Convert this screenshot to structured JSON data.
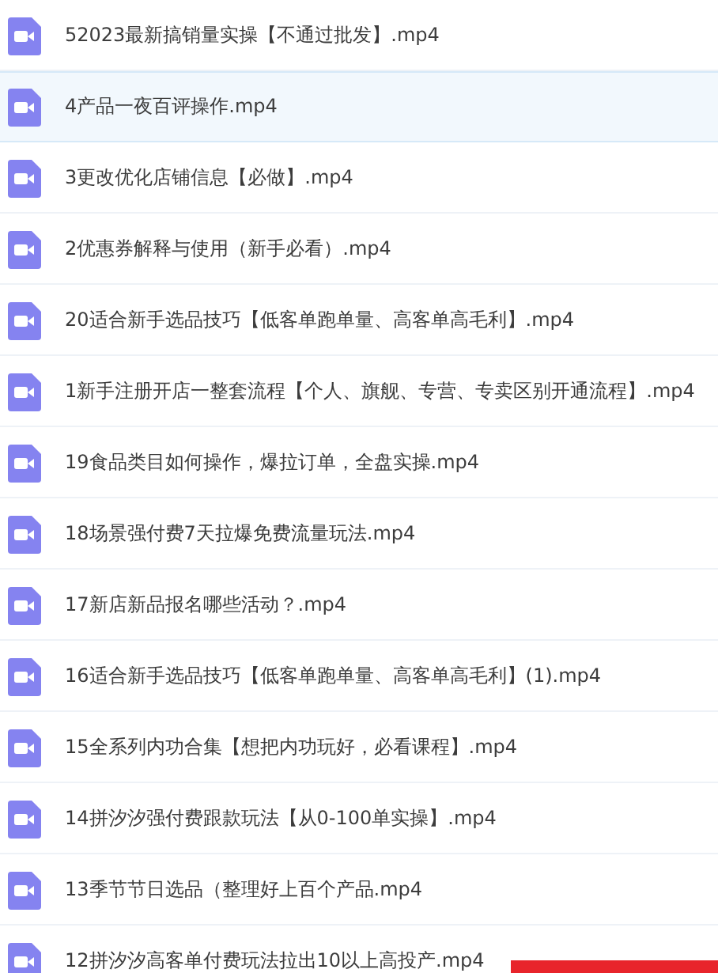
{
  "files": [
    {
      "name": "52023最新搞销量实操【不通过批发】.mp4",
      "selected": false
    },
    {
      "name": "4产品一夜百评操作.mp4",
      "selected": true
    },
    {
      "name": "3更改优化店铺信息【必做】.mp4",
      "selected": false
    },
    {
      "name": "2优惠券解释与使用（新手必看）.mp4",
      "selected": false
    },
    {
      "name": "20适合新手选品技巧【低客单跑单量、高客单高毛利】.mp4",
      "selected": false
    },
    {
      "name": "1新手注册开店一整套流程【个人、旗舰、专营、专卖区别开通流程】.mp4",
      "selected": false
    },
    {
      "name": "19食品类目如何操作，爆拉订单，全盘实操.mp4",
      "selected": false
    },
    {
      "name": "18场景强付费7天拉爆免费流量玩法.mp4",
      "selected": false
    },
    {
      "name": "17新店新品报名哪些活动？.mp4",
      "selected": false
    },
    {
      "name": "16适合新手选品技巧【低客单跑单量、高客单高毛利】(1).mp4",
      "selected": false
    },
    {
      "name": "15全系列内功合集【想把内功玩好，必看课程】.mp4",
      "selected": false
    },
    {
      "name": "14拼汐汐强付费跟款玩法【从0-100单实操】.mp4",
      "selected": false
    },
    {
      "name": "13季节节日选品（整理好上百个产品.mp4",
      "selected": false
    },
    {
      "name": "12拼汐汐高客单付费玩法拉出10以上高投产.mp4",
      "selected": false
    }
  ]
}
